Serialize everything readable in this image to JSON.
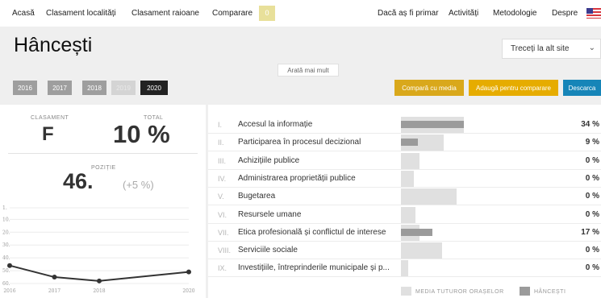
{
  "nav": {
    "items": [
      "Acasă",
      "Clasament localități",
      "Clasament raioane",
      "Comparare"
    ],
    "compare_count": "0",
    "right_items": [
      "Dacă aș fi primar",
      "Activități",
      "Metodologie",
      "Despre"
    ]
  },
  "page": {
    "title": "Hâncești",
    "site_select": "Treceți la alt site",
    "show_more": "Arată mai mult"
  },
  "years": [
    {
      "label": "2016",
      "state": "normal"
    },
    {
      "label": "2017",
      "state": "normal"
    },
    {
      "label": "2018",
      "state": "normal"
    },
    {
      "label": "2019",
      "state": "disabled"
    },
    {
      "label": "2020",
      "state": "active"
    }
  ],
  "actions": {
    "compare_media": "Compară cu media",
    "add_compare": "Adaugă pentru comparare",
    "download": "Descarca"
  },
  "summary": {
    "rank_label": "CLASAMENT",
    "rank": "F",
    "total_label": "TOTAL",
    "total": "10 %",
    "position_label": "POZIȚIE",
    "position": "46.",
    "position_change": "(+5 %)"
  },
  "colors": {
    "compare_media": "#d9a81b",
    "add_compare": "#e6ac00",
    "download": "#1685b8"
  },
  "categories": [
    {
      "num": "I.",
      "label": "Accesul la informație",
      "pct": "34 %"
    },
    {
      "num": "II.",
      "label": "Participarea în procesul decizional",
      "pct": "9 %"
    },
    {
      "num": "III.",
      "label": "Achizițiile publice",
      "pct": "0 %"
    },
    {
      "num": "IV.",
      "label": "Administrarea proprietății publice",
      "pct": "0 %"
    },
    {
      "num": "V.",
      "label": "Bugetarea",
      "pct": "0 %"
    },
    {
      "num": "VI.",
      "label": "Resursele umane",
      "pct": "0 %"
    },
    {
      "num": "VII.",
      "label": "Etica profesională și conflictul de interese",
      "pct": "17 %"
    },
    {
      "num": "VIII.",
      "label": "Serviciile sociale",
      "pct": "0 %"
    },
    {
      "num": "IX.",
      "label": "Investițiile, întreprinderile municipale și p...",
      "pct": "0 %"
    }
  ],
  "legend": {
    "avg": "MEDIA TUTUROR ORAȘELOR",
    "local": "HÂNCEȘTI"
  },
  "chart_data": [
    {
      "type": "bar",
      "categories": [
        "I.",
        "II.",
        "III.",
        "IV.",
        "V.",
        "VI.",
        "VII.",
        "VIII.",
        "IX."
      ],
      "series": [
        {
          "name": "MEDIA TUTUROR ORAȘELOR",
          "values": [
            34,
            23,
            10,
            7,
            30,
            8,
            10,
            22,
            4
          ]
        },
        {
          "name": "HÂNCEȘTI",
          "values": [
            34,
            9,
            0,
            0,
            0,
            0,
            17,
            0,
            0
          ]
        }
      ],
      "ylim": [
        0,
        100
      ]
    },
    {
      "type": "line",
      "x": [
        "2016",
        "2017",
        "2018",
        "2020"
      ],
      "series": [
        {
          "values": [
            46,
            55,
            58,
            51
          ]
        }
      ],
      "yticks": [
        "1.",
        "10.",
        "20.",
        "30.",
        "40.",
        "50.",
        "60."
      ],
      "ylim": [
        1,
        60
      ],
      "grid": true
    }
  ]
}
